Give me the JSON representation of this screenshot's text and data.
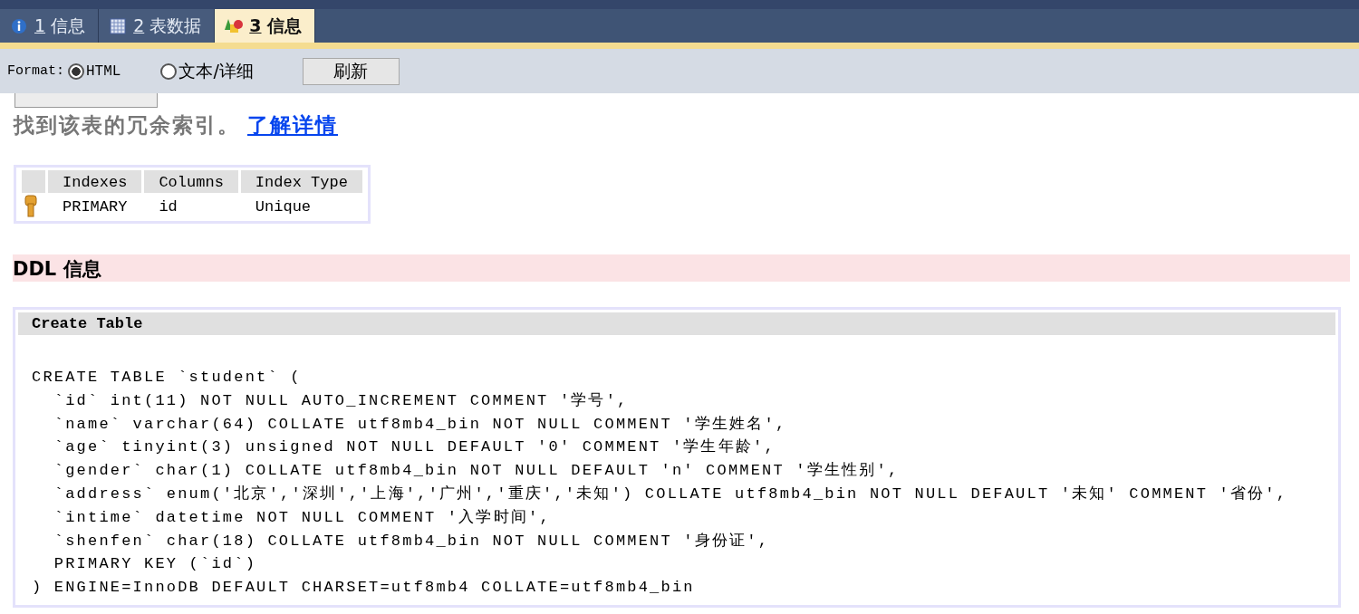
{
  "tabs": [
    {
      "number": "1",
      "label": "信息",
      "kind": "info",
      "selected": false
    },
    {
      "number": "2",
      "label": "表数据",
      "kind": "grid",
      "selected": false
    },
    {
      "number": "3",
      "label": "信息",
      "kind": "shapes",
      "selected": true
    }
  ],
  "toolbar": {
    "format_label": "Format:",
    "options": [
      {
        "label": "HTML",
        "selected": true
      },
      {
        "label": "文本/详细",
        "selected": false
      }
    ],
    "refresh_button": "刷新"
  },
  "hint": {
    "text": "找到该表的冗余索引。",
    "link": "了解详情"
  },
  "index_table": {
    "columns": [
      "Indexes",
      "Columns",
      "Index Type"
    ],
    "rows": [
      {
        "cells": [
          "PRIMARY",
          "id",
          "Unique"
        ],
        "primary": true
      }
    ]
  },
  "ddl_heading": "DDL 信息",
  "ddl": {
    "title": "Create Table",
    "lines": [
      "CREATE TABLE `student` (",
      "  `id` int(11) NOT NULL AUTO_INCREMENT COMMENT '学号',",
      "  `name` varchar(64) COLLATE utf8mb4_bin NOT NULL COMMENT '学生姓名',",
      "  `age` tinyint(3) unsigned NOT NULL DEFAULT '0' COMMENT '学生年龄',",
      "  `gender` char(1) COLLATE utf8mb4_bin NOT NULL DEFAULT 'n' COMMENT '学生性别',",
      "  `address` enum('北京','深圳','上海','广州','重庆','未知') COLLATE utf8mb4_bin NOT NULL DEFAULT '未知' COMMENT '省份',",
      "  `intime` datetime NOT NULL COMMENT '入学时间',",
      "  `shenfen` char(18) COLLATE utf8mb4_bin NOT NULL COMMENT '身份证',",
      "  PRIMARY KEY (`id`)",
      ") ENGINE=InnoDB DEFAULT CHARSET=utf8mb4 COLLATE=utf8mb4_bin"
    ]
  }
}
